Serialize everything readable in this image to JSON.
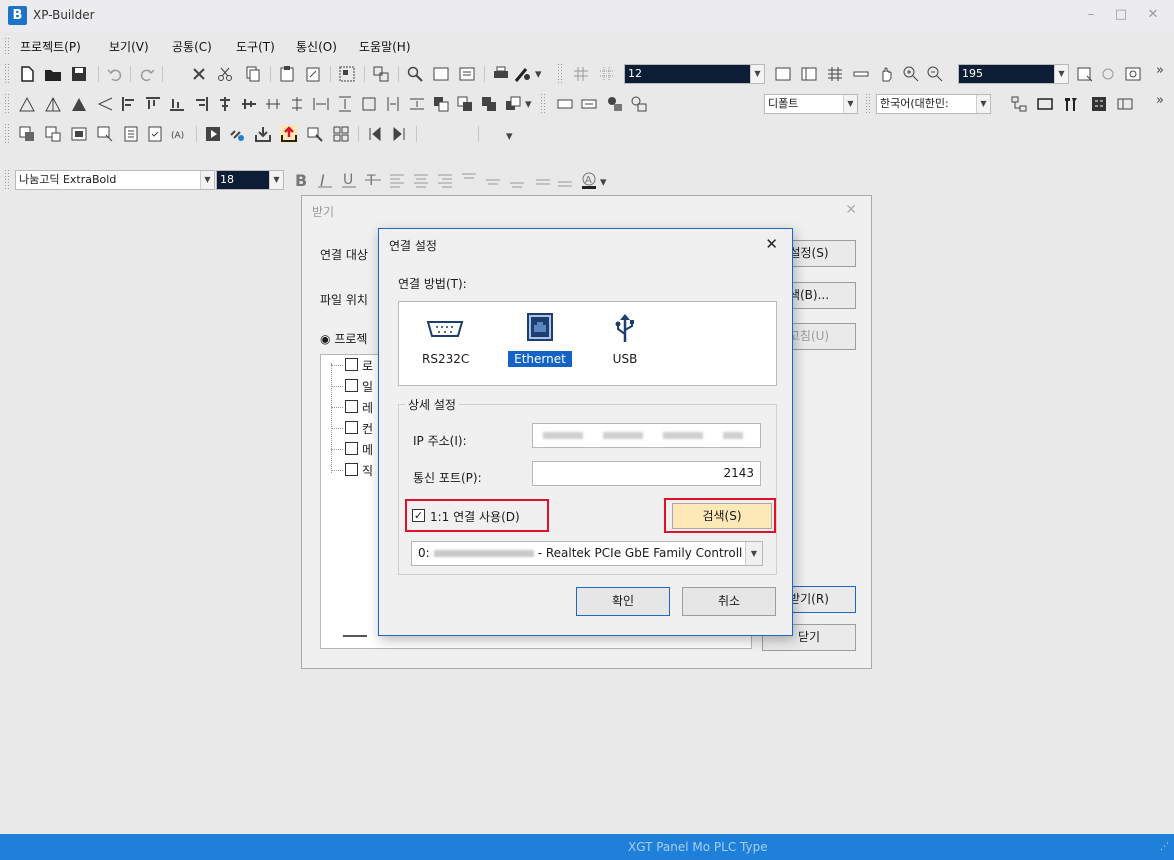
{
  "app": {
    "logo": "B",
    "title": "XP-Builder"
  },
  "window_controls": {
    "minimize": "–",
    "maximize": "□",
    "close": "✕"
  },
  "menu": [
    "프로젝트(P)",
    "보기(V)",
    "공통(C)",
    "도구(T)",
    "통신(O)",
    "도움말(H)"
  ],
  "toolbar": {
    "grid_size": "12",
    "zoom": "195",
    "font_default": "디폴트",
    "language": "한국어(대한민:",
    "font_name": "나눔고딕 ExtraBold",
    "font_size": "18",
    "more": "»"
  },
  "back_dialog": {
    "title": "받기",
    "close": "✕",
    "label_target": "연결 대상",
    "label_location": "파일 위치",
    "radio_project": "프로젝",
    "btn_settings": "설정(S)",
    "btn_browse": "색(B)...",
    "btn_refresh": "고침(U)",
    "btn_receive": "받기(R)",
    "btn_close": "닫기",
    "tree_items": [
      "로",
      "일",
      "레",
      "컨",
      "메",
      "직"
    ]
  },
  "conn_dialog": {
    "title": "연결 설정",
    "close": "✕",
    "method_label": "연결 방법(T):",
    "methods": [
      {
        "name": "RS232C",
        "icon": "serial-port-icon",
        "selected": false
      },
      {
        "name": "Ethernet",
        "icon": "ethernet-port-icon",
        "selected": true
      },
      {
        "name": "USB",
        "icon": "usb-icon",
        "selected": false
      }
    ],
    "detail_title": "상세 설정",
    "ip_label": "IP 주소(I):",
    "port_label": "통신 포트(P):",
    "port_value": "2143",
    "one_to_one_label": "1:1 연결 사용(D)",
    "one_to_one_checked": "✓",
    "search_btn": "검색(S)",
    "adapter_prefix": "0:",
    "adapter_name": "- Realtek PCIe GbE Family Controll",
    "ok_btn": "확인",
    "cancel_btn": "취소"
  },
  "statusbar": {
    "text": "XGT Panel Mo  PLC Type",
    "grip": "⋰"
  },
  "colors": {
    "accent": "#1e80d8",
    "highlight": "#e0102b",
    "search_bg": "#fde9b7"
  }
}
